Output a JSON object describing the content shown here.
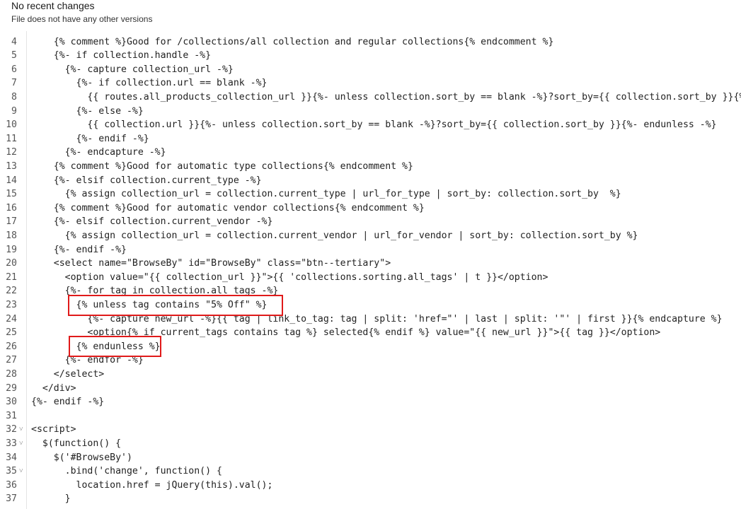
{
  "header": {
    "title": "No recent changes",
    "subtitle": "File does not have any other versions"
  },
  "code_lines": [
    {
      "n": "4",
      "text": "    {% comment %}Good for /collections/all collection and regular collections{% endcomment %}"
    },
    {
      "n": "5",
      "text": "    {%- if collection.handle -%}"
    },
    {
      "n": "6",
      "text": "      {%- capture collection_url -%}"
    },
    {
      "n": "7",
      "text": "        {%- if collection.url == blank -%}"
    },
    {
      "n": "8",
      "text": "          {{ routes.all_products_collection_url }}{%- unless collection.sort_by == blank -%}?sort_by={{ collection.sort_by }}{%- en"
    },
    {
      "n": "9",
      "text": "        {%- else -%}"
    },
    {
      "n": "10",
      "text": "          {{ collection.url }}{%- unless collection.sort_by == blank -%}?sort_by={{ collection.sort_by }}{%- endunless -%}"
    },
    {
      "n": "11",
      "text": "        {%- endif -%}"
    },
    {
      "n": "12",
      "text": "      {%- endcapture -%}"
    },
    {
      "n": "13",
      "text": "    {% comment %}Good for automatic type collections{% endcomment %}"
    },
    {
      "n": "14",
      "text": "    {%- elsif collection.current_type -%}"
    },
    {
      "n": "15",
      "text": "      {% assign collection_url = collection.current_type | url_for_type | sort_by: collection.sort_by  %}"
    },
    {
      "n": "16",
      "text": "    {% comment %}Good for automatic vendor collections{% endcomment %}"
    },
    {
      "n": "17",
      "text": "    {%- elsif collection.current_vendor -%}"
    },
    {
      "n": "18",
      "text": "      {% assign collection_url = collection.current_vendor | url_for_vendor | sort_by: collection.sort_by %}"
    },
    {
      "n": "19",
      "text": "    {%- endif -%}"
    },
    {
      "n": "20",
      "text": "    <select name=\"BrowseBy\" id=\"BrowseBy\" class=\"btn--tertiary\">"
    },
    {
      "n": "21",
      "text": "      <option value=\"{{ collection_url }}\">{{ 'collections.sorting.all_tags' | t }}</option>"
    },
    {
      "n": "22",
      "text": "      {%- for tag in collection.all_tags -%}"
    },
    {
      "n": "23",
      "text": "        {% unless tag contains \"5% Off\" %}"
    },
    {
      "n": "24",
      "text": "          {%- capture new_url -%}{{ tag | link_to_tag: tag | split: 'href=\"' | last | split: '\"' | first }}{% endcapture %}"
    },
    {
      "n": "25",
      "text": "          <option{% if current_tags contains tag %} selected{% endif %} value=\"{{ new_url }}\">{{ tag }}</option>"
    },
    {
      "n": "26",
      "text": "        {% endunless %}"
    },
    {
      "n": "27",
      "text": "      {%- endfor -%}"
    },
    {
      "n": "28",
      "text": "    </select>"
    },
    {
      "n": "29",
      "text": "  </div>"
    },
    {
      "n": "30",
      "text": "{%- endif -%}"
    },
    {
      "n": "31",
      "text": ""
    },
    {
      "n": "32",
      "text": "<script>",
      "fold": true
    },
    {
      "n": "33",
      "text": "  $(function() {",
      "fold": true
    },
    {
      "n": "34",
      "text": "    $('#BrowseBy')"
    },
    {
      "n": "35",
      "text": "      .bind('change', function() {",
      "fold": true
    },
    {
      "n": "36",
      "text": "        location.href = jQuery(this).val();"
    },
    {
      "n": "37",
      "text": "      }"
    }
  ],
  "fold_icon": "chevron-down-icon",
  "highlight_color": "#e01a1a"
}
